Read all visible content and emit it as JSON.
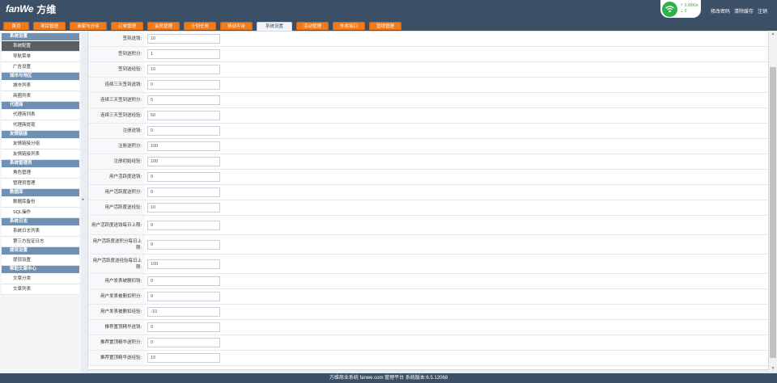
{
  "header": {
    "logo_mark": "fanWe",
    "logo_text": "方维",
    "net": {
      "speed": "0.00K/s",
      "count": "0"
    },
    "links": [
      "修改密码",
      "清除缓存",
      "注销"
    ]
  },
  "nav": {
    "tabs": [
      {
        "label": "首页",
        "width": 32
      },
      {
        "label": "项目管理",
        "width": 40
      },
      {
        "label": "商家与分评",
        "width": 46
      },
      {
        "label": "订单管理",
        "width": 40
      },
      {
        "label": "会员管理",
        "width": 40
      },
      {
        "label": "计划任务",
        "width": 40
      },
      {
        "label": "移动平台",
        "width": 40
      },
      {
        "label": "系统设置",
        "width": 44,
        "active": true
      },
      {
        "label": "活动管理",
        "width": 40
      },
      {
        "label": "外发接口",
        "width": 40
      },
      {
        "label": "营销管理",
        "width": 40
      }
    ]
  },
  "sidebar": {
    "sections": [
      {
        "title": "系统设置",
        "items": [
          "系统配置",
          "导航菜单",
          "广告设置"
        ]
      },
      {
        "title": "城市与地区",
        "items": [
          "城市列表",
          "商圈列表"
        ]
      },
      {
        "title": "代理商",
        "items": [
          "代理商列表",
          "代理商提现"
        ]
      },
      {
        "title": "友情链接",
        "items": [
          "友情链接分组",
          "友情链接列表"
        ]
      },
      {
        "title": "系统管理员",
        "items": [
          "角色管理",
          "管理员管理"
        ]
      },
      {
        "title": "数据库",
        "items": [
          "数据库备份",
          "SQL操作"
        ]
      },
      {
        "title": "系统日志",
        "items": [
          "系统日志列表",
          "第三方验证日志"
        ]
      },
      {
        "title": "提现设置",
        "items": [
          "提现设置"
        ]
      },
      {
        "title": "帮助文章中心",
        "items": [
          "文章分类",
          "文章列表"
        ]
      }
    ],
    "active_item": "系统配置"
  },
  "form": {
    "rows": [
      {
        "label": "签到送钱:",
        "value": "10",
        "h": 19
      },
      {
        "label": "签到送积分:",
        "value": "1",
        "h": 19
      },
      {
        "label": "签到送经验:",
        "value": "10",
        "h": 19
      },
      {
        "label": "连续三天签到送钱:",
        "value": "0",
        "h": 19
      },
      {
        "label": "连续三天签到送积分:",
        "value": "5",
        "h": 19
      },
      {
        "label": "连续三天签到送经验:",
        "value": "50",
        "h": 19
      },
      {
        "label": "注册送钱:",
        "value": "0",
        "h": 19
      },
      {
        "label": "注册送积分:",
        "value": "100",
        "h": 19
      },
      {
        "label": "注册初始经验:",
        "value": "100",
        "h": 19
      },
      {
        "label": "用户活跃度送钱:",
        "value": "0",
        "h": 19
      },
      {
        "label": "用户活跃度送积分:",
        "value": "0",
        "h": 19
      },
      {
        "label": "用户活跃度送经验:",
        "value": "10",
        "h": 19
      },
      {
        "label": "用户活跃度送钱每日上限:",
        "value": "0",
        "h": 24
      },
      {
        "label": "用户活跃度送积分每日上限:",
        "value": "0",
        "h": 24
      },
      {
        "label": "用户活跃度送经验每日上限:",
        "value": "100",
        "h": 24
      },
      {
        "label": "用户发表被删扣钱:",
        "value": "0",
        "h": 19
      },
      {
        "label": "用户发表被删扣积分:",
        "value": "0",
        "h": 19
      },
      {
        "label": "用户发表被删扣经验:",
        "value": "-10",
        "h": 19
      },
      {
        "label": "推荐置顶精华送钱:",
        "value": "0",
        "h": 19
      },
      {
        "label": "推荐置顶精华送积分:",
        "value": "0",
        "h": 19
      },
      {
        "label": "推荐置顶精华送经验:",
        "value": "10",
        "h": 19
      }
    ]
  },
  "footer": {
    "text": "方维商业系统 fanwe.com 管理平台 系统版本:6.5.12068"
  }
}
